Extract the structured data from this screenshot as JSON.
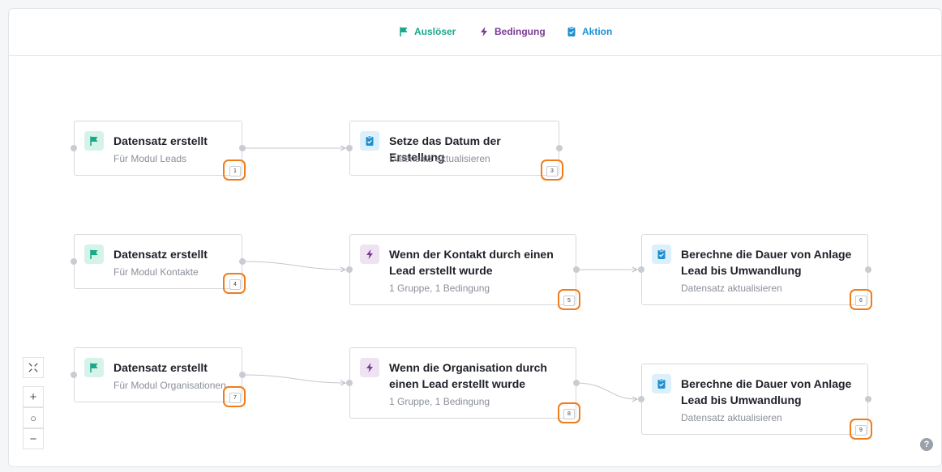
{
  "colors": {
    "trigger": "#1aa88b",
    "condition": "#7b3a93",
    "action": "#1e8fd1",
    "highlight": "#f07d1c"
  },
  "legend": {
    "trigger": {
      "label": "Auslöser",
      "icon": "flag-icon"
    },
    "condition": {
      "label": "Bedingung",
      "icon": "lightning-icon"
    },
    "action": {
      "label": "Aktion",
      "icon": "clipboard-check-icon"
    }
  },
  "nodes": {
    "n1": {
      "type": "trigger",
      "icon": "flag-icon",
      "title": "Datensatz erstellt",
      "subtitle": "Für Modul Leads",
      "badge": "1"
    },
    "n3": {
      "type": "action",
      "icon": "clipboard-check-icon",
      "title": "Setze das Datum der Erstellung",
      "subtitle": "Datensatz aktualisieren",
      "badge": "3"
    },
    "n4": {
      "type": "trigger",
      "icon": "flag-icon",
      "title": "Datensatz erstellt",
      "subtitle": "Für Modul Kontakte",
      "badge": "4"
    },
    "n5": {
      "type": "condition",
      "icon": "lightning-icon",
      "title": "Wenn der Kontakt durch einen Lead erstellt wurde",
      "subtitle": "1 Gruppe, 1 Bedingung",
      "badge": "5"
    },
    "n6": {
      "type": "action",
      "icon": "clipboard-check-icon",
      "title": "Berechne die Dauer von Anlage Lead bis Umwandlung",
      "subtitle": "Datensatz aktualisieren",
      "badge": "6"
    },
    "n7": {
      "type": "trigger",
      "icon": "flag-icon",
      "title": "Datensatz erstellt",
      "subtitle": "Für Modul Organisationen",
      "badge": "7"
    },
    "n8": {
      "type": "condition",
      "icon": "lightning-icon",
      "title": "Wenn die Organisation durch einen Lead erstellt wurde",
      "subtitle": "1 Gruppe, 1 Bedingung",
      "badge": "8"
    },
    "n9": {
      "type": "action",
      "icon": "clipboard-check-icon",
      "title": "Berechne die Dauer von Anlage Lead bis Umwandlung",
      "subtitle": "Datensatz aktualisieren",
      "badge": "9"
    }
  },
  "controls": {
    "fit": "fit-view-icon",
    "zoom_in": "+",
    "reset": "○",
    "zoom_out": "−"
  },
  "help": "?"
}
